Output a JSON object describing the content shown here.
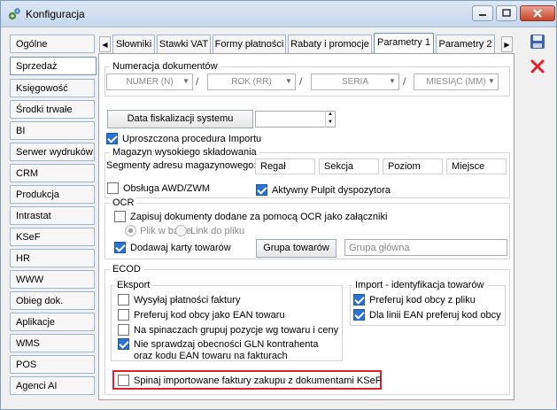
{
  "window": {
    "title": "Konfiguracja"
  },
  "nav": {
    "items": [
      "Ogólne",
      "Sprzedaż",
      "Księgowość",
      "Środki trwałe",
      "BI",
      "Serwer wydruków",
      "CRM",
      "Produkcja",
      "Intrastat",
      "KSeF",
      "HR",
      "WWW",
      "Obieg dok.",
      "Aplikacje",
      "WMS",
      "POS",
      "Agenci AI"
    ],
    "active": "Sprzedaż"
  },
  "tabs": {
    "items": [
      "Słowniki",
      "Stawki VAT",
      "Formy płatności",
      "Rabaty i promocje",
      "Parametry 1",
      "Parametry 2"
    ],
    "active": "Parametry 1"
  },
  "numeracja": {
    "title": "Numeracja dokumentów",
    "combos": [
      "NUMER (N)",
      "ROK (RR)",
      "SERIA",
      "MIESIĄC (MM)"
    ],
    "separator": "/"
  },
  "fiskalizacja": {
    "button": "Data fiskalizacji systemu",
    "value": ""
  },
  "uproszczona": {
    "label": "Uproszczona procedura Importu",
    "checked": true
  },
  "magazyn": {
    "title": "Magazyn wysokiego składowania",
    "segments_label": "Segmenty adresu magazynowego:",
    "segments": [
      "Regał",
      "Sekcja",
      "Poziom",
      "Miejsce"
    ],
    "awd": {
      "label": "Obsługa AWD/ZWM",
      "checked": false
    },
    "pulpit": {
      "label": "Aktywny Pulpit dyspozytora",
      "checked": true
    }
  },
  "ocr": {
    "title": "OCR",
    "zapisuj": {
      "label": "Zapisuj dokumenty dodane za pomocą OCR jako załączniki",
      "checked": false
    },
    "plik_w_bazie": "Plik w bazie",
    "link_do_pliku": "Link do pliku",
    "dodawaj": {
      "label": "Dodawaj karty towarów",
      "checked": true
    },
    "grupa_button": "Grupa towarów",
    "grupa_value": "Grupa główna"
  },
  "ecod": {
    "title": "ECOD",
    "eksport": {
      "title": "Eksport",
      "items": [
        {
          "label": "Wysyłaj płatności faktury",
          "checked": false
        },
        {
          "label": "Preferuj kod obcy jako EAN towaru",
          "checked": false
        },
        {
          "label": "Na spinaczach grupuj pozycje wg towaru i ceny",
          "checked": false
        },
        {
          "label": "Nie sprawdzaj obecności GLN kontrahenta",
          "label2": "oraz kodu EAN towaru na fakturach",
          "checked": true
        }
      ]
    },
    "import": {
      "title": "Import - identyfikacja towarów",
      "items": [
        {
          "label": "Preferuj kod obcy z pliku",
          "checked": true
        },
        {
          "label": "Dla linii EAN preferuj kod obcy",
          "checked": true
        }
      ]
    },
    "spinaj": {
      "label": "Spinaj importowane faktury zakupu z dokumentami KSeF",
      "checked": false
    }
  },
  "colors": {
    "accent": "#2a72d4",
    "highlight": "#e0202a"
  }
}
